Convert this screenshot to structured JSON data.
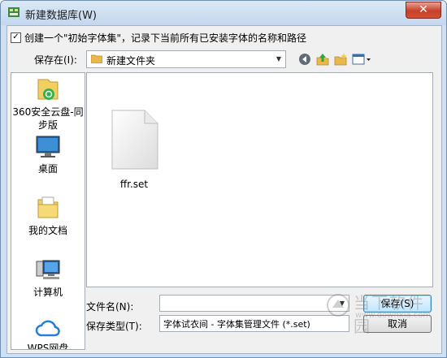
{
  "window": {
    "title": "新建数据库(W)",
    "close_glyph": "✕"
  },
  "options": {
    "create_initial_set_label": "创建一个\"初始字体集\"，记录下当前所有已安装字体的名称和路径",
    "create_initial_set_checked": true
  },
  "location": {
    "label": "保存在(I):",
    "current_folder": "新建文件夹"
  },
  "toolbar": {
    "back_icon": "back-icon",
    "up_icon": "up-folder-icon",
    "new_folder_icon": "new-folder-icon",
    "view_menu_icon": "view-menu-icon"
  },
  "places": {
    "items": [
      {
        "label": "360安全云盘-同步版",
        "icon": "cloud-drive-icon"
      },
      {
        "label": "桌面",
        "icon": "desktop-icon"
      },
      {
        "label": "我的文档",
        "icon": "documents-icon"
      },
      {
        "label": "计算机",
        "icon": "computer-icon"
      },
      {
        "label": "WPS网盘",
        "icon": "wps-cloud-icon"
      }
    ]
  },
  "files": [
    {
      "name": "ffr.set",
      "icon": "file-icon"
    }
  ],
  "filename": {
    "label": "文件名(N):",
    "value": ""
  },
  "filetype": {
    "label": "保存类型(T):",
    "value": "字体试衣间 - 字体集管理文件 (*.set)"
  },
  "buttons": {
    "save": "保存(S)",
    "cancel": "取消"
  },
  "watermark": {
    "text": "当下软件园",
    "url": "www.downxia.com"
  },
  "colors": {
    "title_bar": "#c4d7ee",
    "close_button": "#c7402a",
    "default_button": "#bee6fd"
  }
}
